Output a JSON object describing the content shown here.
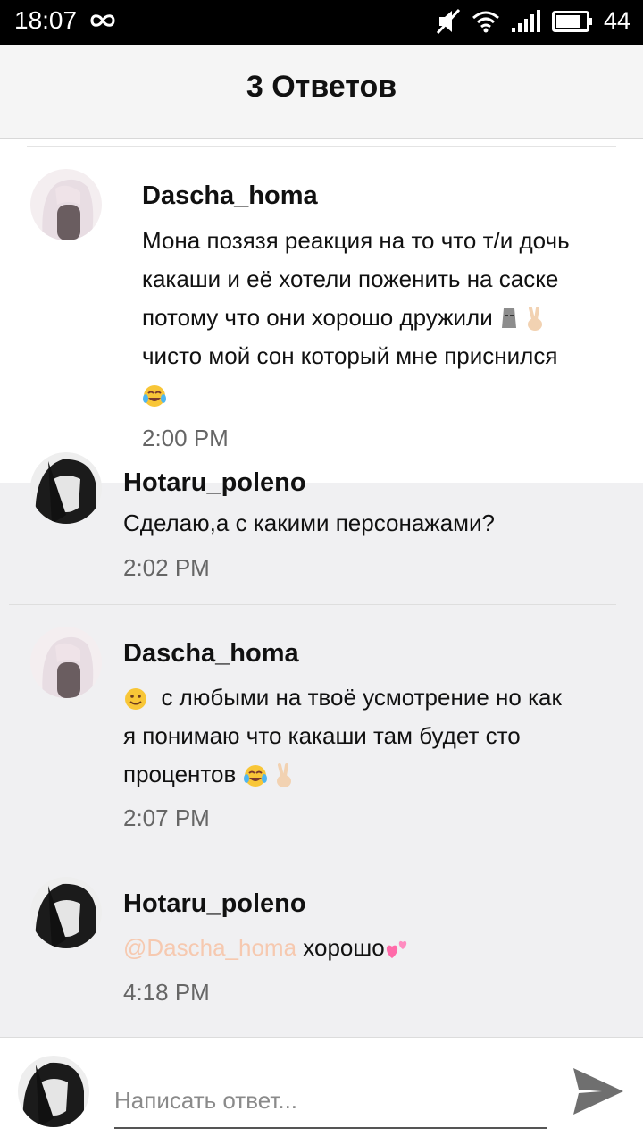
{
  "status_bar": {
    "time": "18:07",
    "battery": "44"
  },
  "header": {
    "title": "3 Ответов"
  },
  "main_comment": {
    "username": "Dascha_homa",
    "lines": [
      "Мона позязя реакция на то что т/и дочь",
      "какаши и её хотели поженить на саске",
      "потому что они хорошо дружили"
    ],
    "line4": "чисто мой сон который мне приснился",
    "time": "2:00 PM"
  },
  "replies": [
    {
      "username": "Hotaru_poleno",
      "text": "Сделаю,а с какими персонажами?",
      "time": "2:02 PM"
    },
    {
      "username": "Dascha_homa",
      "line1": "с любыми на твоё усмотрение но как",
      "line2": "я понимаю что какаши там будет сто",
      "line3": "процентов",
      "time": "2:07 PM"
    },
    {
      "username": "Hotaru_poleno",
      "mention": "@Dascha_homa",
      "text": "хорошо",
      "time": "4:18 PM"
    }
  ],
  "reply_box": {
    "placeholder": "Написать ответ..."
  },
  "colors": {
    "mention": "#f6c9b0",
    "title": "#111111",
    "timestamp": "#666666"
  }
}
